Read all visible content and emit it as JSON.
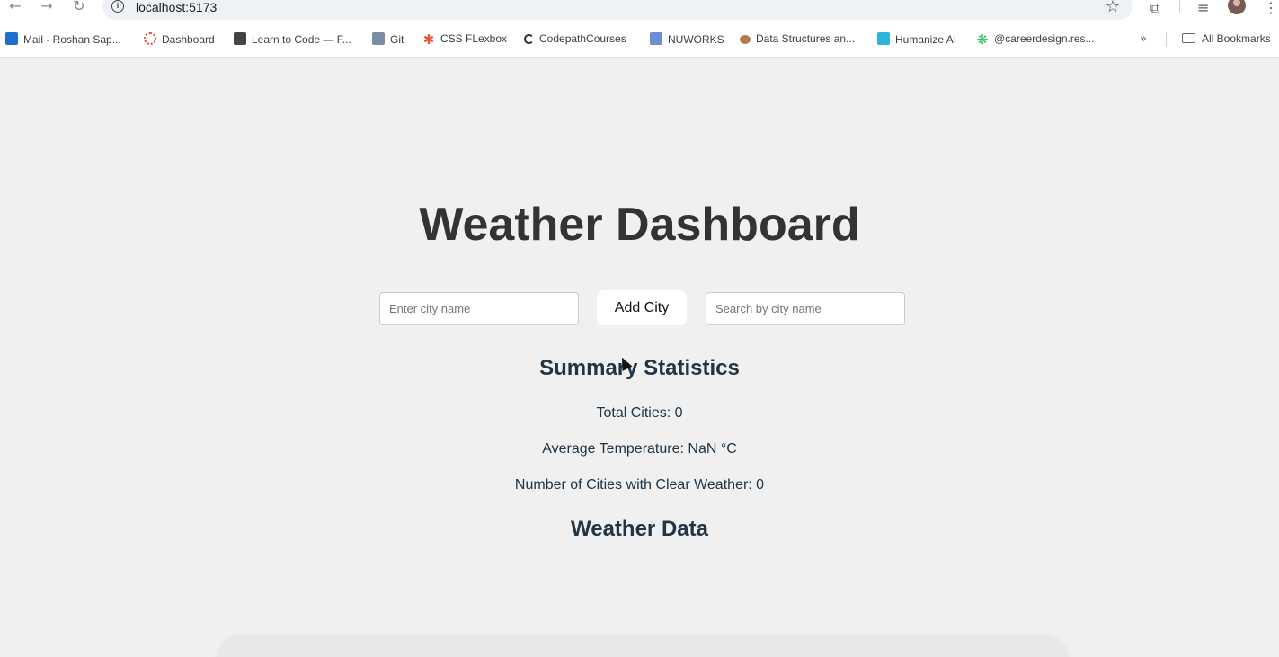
{
  "browser": {
    "url": "localhost:5173",
    "bookmarks": [
      {
        "label": "Mail - Roshan Sap...",
        "icon": "outlook-icon",
        "color": "#1e6fd0"
      },
      {
        "label": "Dashboard",
        "icon": "canvas-icon",
        "color": "#e0523a"
      },
      {
        "label": "Learn to Code — F...",
        "icon": "freecodecamp-icon",
        "color": "#444444"
      },
      {
        "label": "Git",
        "icon": "tds-icon",
        "color": "#7a8ca3"
      },
      {
        "label": "CSS FLexbox",
        "icon": "css-tricks-icon",
        "color": "#e6542e"
      },
      {
        "label": "CodepathCourses",
        "icon": "codepath-icon",
        "color": "#333333"
      },
      {
        "label": "NUWORKS",
        "icon": "nuworks-icon",
        "color": "#6f8ed1"
      },
      {
        "label": "Data Structures an...",
        "icon": "datastructures-icon",
        "color": "#b07a4c"
      },
      {
        "label": "Humanize AI",
        "icon": "humanize-icon",
        "color": "#29b6d8"
      },
      {
        "label": "@careerdesign.res...",
        "icon": "careerdesign-icon",
        "color": "#3bbf5a"
      }
    ],
    "all_bookmarks": "All Bookmarks"
  },
  "app": {
    "title": "Weather Dashboard",
    "city_input_placeholder": "Enter city name",
    "add_button": "Add City",
    "search_placeholder": "Search by city name",
    "summary_heading": "Summary Statistics",
    "stats": [
      {
        "label": "Total Cities:",
        "value": "0"
      },
      {
        "label": "Average Temperature:",
        "value": "NaN °C"
      },
      {
        "label": "Number of Cities with Clear Weather:",
        "value": "0"
      }
    ],
    "data_heading": "Weather Data"
  }
}
